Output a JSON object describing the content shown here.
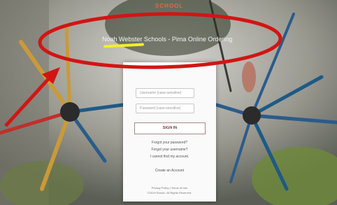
{
  "brand": "SCHOOL",
  "header": {
    "title": "Noah Webster Schools - Pima Online Ordering"
  },
  "login": {
    "username_placeholder": "Username (case-sensitive)",
    "password_placeholder": "Password (case-sensitive)",
    "sign_in_label": "SIGN IN",
    "forgot_password": "Forgot your password?",
    "forgot_username": "Forgot your username?",
    "cannot_find_account": "I cannot find my account.",
    "create_account": "Create an Account"
  },
  "footer": {
    "links": "Privacy Policy  |  Terms of Use",
    "copyright": "©2019 Rosnic. All Rights Reserved."
  },
  "colors": {
    "annotation": "#d31414",
    "highlight": "#f3ee2a",
    "brand_accent": "#e26a3c"
  }
}
